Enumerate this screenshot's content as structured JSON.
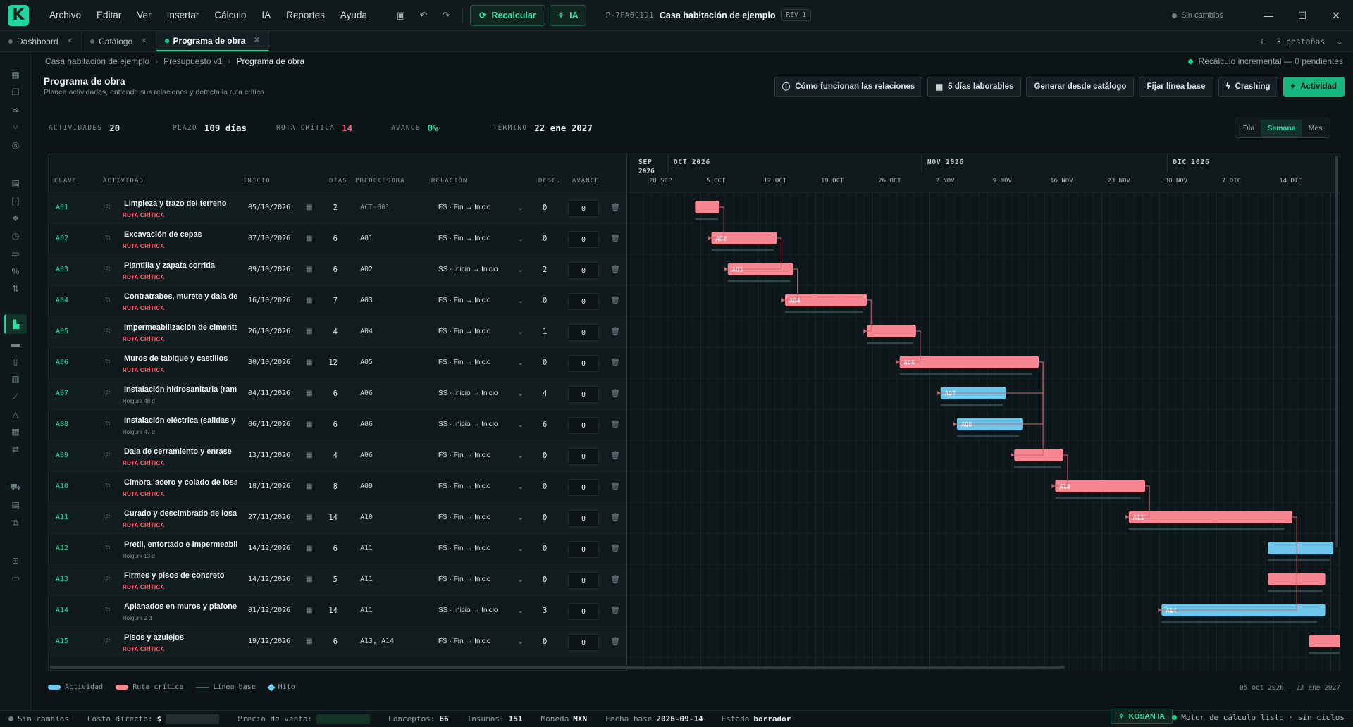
{
  "app": {
    "logo": "K"
  },
  "menu": [
    "Archivo",
    "Editar",
    "Ver",
    "Insertar",
    "Cálculo",
    "IA",
    "Reportes",
    "Ayuda"
  ],
  "toolbar": {
    "recalc_label": "Recalcular",
    "ia_label": "IA"
  },
  "project": {
    "id": "P-7FA6C1D1",
    "name": "Casa habitación de ejemplo",
    "rev": "REV 1"
  },
  "window": {
    "status": "Sin cambios"
  },
  "tabs": [
    {
      "label": "Dashboard",
      "active": false
    },
    {
      "label": "Catálogo",
      "active": false
    },
    {
      "label": "Programa de obra",
      "active": true
    }
  ],
  "tabbar": {
    "add": "+",
    "count": "3 pestañas"
  },
  "breadcrumb": [
    "Casa habitación de ejemplo",
    "Presupuesto v1",
    "Programa de obra"
  ],
  "incremental": "Recálculo incremental — 0 pendientes",
  "header": {
    "title": "Programa de obra",
    "subtitle": "Planea actividades, entiende sus relaciones y detecta la ruta crítica"
  },
  "actions": [
    "Cómo funcionan las relaciones",
    "5 días laborables",
    "Generar desde catálogo",
    "Fijar línea base",
    "Crashing",
    "Actividad"
  ],
  "stats": [
    {
      "label": "ACTIVIDADES",
      "value": "20",
      "color": "#eef3f3"
    },
    {
      "label": "PLAZO",
      "value": "109 días",
      "color": "#eef3f3"
    },
    {
      "label": "RUTA CRÍTICA",
      "value": "14",
      "color": "#ff5c72"
    },
    {
      "label": "AVANCE",
      "value": "0%",
      "color": "#2dd69f"
    },
    {
      "label": "TÉRMINO",
      "value": "22 ene 2027",
      "color": "#eef3f3"
    }
  ],
  "views": [
    {
      "label": "Día",
      "on": false
    },
    {
      "label": "Semana",
      "on": true
    },
    {
      "label": "Mes",
      "on": false
    }
  ],
  "columns": [
    "CLAVE",
    "ACTIVIDAD",
    "INICIO",
    "DÍAS",
    "PREDECESORA",
    "RELACIÓN",
    "DESF.",
    "AVANCE"
  ],
  "rows": [
    {
      "key": "A01",
      "name": "Limpieza y trazo del terreno",
      "tag": "RUTA CRÍTICA",
      "critical": true,
      "start": "05/10/2026",
      "days": "2",
      "pred": "ACT-001",
      "pred_muted": true,
      "rel": "FS · Fin → Inicio",
      "lag": "0",
      "progress": "0"
    },
    {
      "key": "A02",
      "name": "Excavación de cepas",
      "tag": "RUTA CRÍTICA",
      "critical": true,
      "start": "07/10/2026",
      "days": "6",
      "pred": "A01",
      "rel": "FS · Fin → Inicio",
      "lag": "0",
      "progress": "0"
    },
    {
      "key": "A03",
      "name": "Plantilla y zapata corrida",
      "tag": "RUTA CRÍTICA",
      "critical": true,
      "start": "09/10/2026",
      "days": "6",
      "pred": "A02",
      "rel": "SS · Inicio → Inicio",
      "lag": "2",
      "progress": "0"
    },
    {
      "key": "A04",
      "name": "Contratrabes, murete y dala de d",
      "tag": "RUTA CRÍTICA",
      "critical": true,
      "start": "16/10/2026",
      "days": "7",
      "pred": "A03",
      "rel": "FS · Fin → Inicio",
      "lag": "0",
      "progress": "0"
    },
    {
      "key": "A05",
      "name": "Impermeabilización de cimentac",
      "tag": "RUTA CRÍTICA",
      "critical": true,
      "start": "26/10/2026",
      "days": "4",
      "pred": "A04",
      "rel": "FS · Fin → Inicio",
      "lag": "1",
      "progress": "0"
    },
    {
      "key": "A06",
      "name": "Muros de tabique y castillos",
      "tag": "RUTA CRÍTICA",
      "critical": true,
      "start": "30/10/2026",
      "days": "12",
      "pred": "A05",
      "rel": "FS · Fin → Inicio",
      "lag": "0",
      "progress": "0"
    },
    {
      "key": "A07",
      "name": "Instalación hidrosanitaria (ramal",
      "tag": "Holgura 48 d",
      "critical": false,
      "start": "04/11/2026",
      "days": "6",
      "pred": "A06",
      "rel": "SS · Inicio → Inicio",
      "lag": "4",
      "progress": "0"
    },
    {
      "key": "A08",
      "name": "Instalación eléctrica (salidas y ca",
      "tag": "Holgura 47 d",
      "critical": false,
      "start": "06/11/2026",
      "days": "6",
      "pred": "A06",
      "rel": "SS · Inicio → Inicio",
      "lag": "6",
      "progress": "0"
    },
    {
      "key": "A09",
      "name": "Dala de cerramiento y enrase",
      "tag": "RUTA CRÍTICA",
      "critical": true,
      "start": "13/11/2026",
      "days": "4",
      "pred": "A06",
      "rel": "FS · Fin → Inicio",
      "lag": "0",
      "progress": "0"
    },
    {
      "key": "A10",
      "name": "Cimbra, acero y colado de losa",
      "tag": "RUTA CRÍTICA",
      "critical": true,
      "start": "18/11/2026",
      "days": "8",
      "pred": "A09",
      "rel": "FS · Fin → Inicio",
      "lag": "0",
      "progress": "0"
    },
    {
      "key": "A11",
      "name": "Curado y descimbrado de losa",
      "tag": "RUTA CRÍTICA",
      "critical": true,
      "start": "27/11/2026",
      "days": "14",
      "pred": "A10",
      "rel": "FS · Fin → Inicio",
      "lag": "0",
      "progress": "0"
    },
    {
      "key": "A12",
      "name": "Pretil, entortado e impermeabiliz",
      "tag": "Holgura 13 d",
      "critical": false,
      "start": "14/12/2026",
      "days": "6",
      "pred": "A11",
      "rel": "FS · Fin → Inicio",
      "lag": "0",
      "progress": "0"
    },
    {
      "key": "A13",
      "name": "Firmes y pisos de concreto",
      "tag": "RUTA CRÍTICA",
      "critical": true,
      "start": "14/12/2026",
      "days": "5",
      "pred": "A11",
      "rel": "FS · Fin → Inicio",
      "lag": "0",
      "progress": "0"
    },
    {
      "key": "A14",
      "name": "Aplanados en muros y plafones",
      "tag": "Holgura 2 d",
      "critical": false,
      "start": "01/12/2026",
      "days": "14",
      "pred": "A11",
      "rel": "SS · Inicio → Inicio",
      "lag": "3",
      "progress": "0"
    },
    {
      "key": "A15",
      "name": "Pisos y azulejos",
      "tag": "RUTA CRÍTICA",
      "critical": true,
      "start": "19/12/2026",
      "days": "6",
      "pred": "A13, A14",
      "rel": "FS · Fin → Inicio",
      "lag": "0",
      "progress": "0"
    }
  ],
  "gantt": {
    "months": [
      {
        "label": "SEP",
        "sub": "2026"
      },
      {
        "label": "OCT 2026"
      },
      {
        "label": "NOV 2026"
      },
      {
        "label": "DIC 2026"
      }
    ],
    "weeks": [
      "28 SEP",
      "5 OCT",
      "12 OCT",
      "19 OCT",
      "26 OCT",
      "2 NOV",
      "9 NOV",
      "16 NOV",
      "23 NOV",
      "30 NOV",
      "7 DIC",
      "14 DIC"
    ],
    "bar_labels": [
      "",
      "A02",
      "A03",
      "A04",
      "",
      "A06",
      "A07",
      "A08",
      "",
      "A10",
      "A11",
      "",
      "",
      "A14",
      ""
    ]
  },
  "legend": [
    "Actividad",
    "Ruta crítica",
    "Línea base",
    "Hito"
  ],
  "range": "05 oct 2026 — 22 ene 2027",
  "statusbar": {
    "status": "Sin cambios",
    "direct_cost_label": "Costo directo:",
    "direct_cost_prefix": "$",
    "sale_price_label": "Precio de venta:",
    "concepts_label": "Conceptos:",
    "concepts": "66",
    "inputs_label": "Insumos:",
    "inputs": "151",
    "currency_label": "Moneda",
    "currency": "MXN",
    "base_date_label": "Fecha base",
    "base_date": "2026-09-14",
    "state_label": "Estado",
    "state": "borrador",
    "kosan": "KOSAN IA",
    "engine": "Motor de cálculo listo · sin ciclos"
  },
  "colors": {
    "accent": "#1fd6a0",
    "critical": "#f88592",
    "activity": "#6ec6ea",
    "baseline": "#2f4549"
  }
}
